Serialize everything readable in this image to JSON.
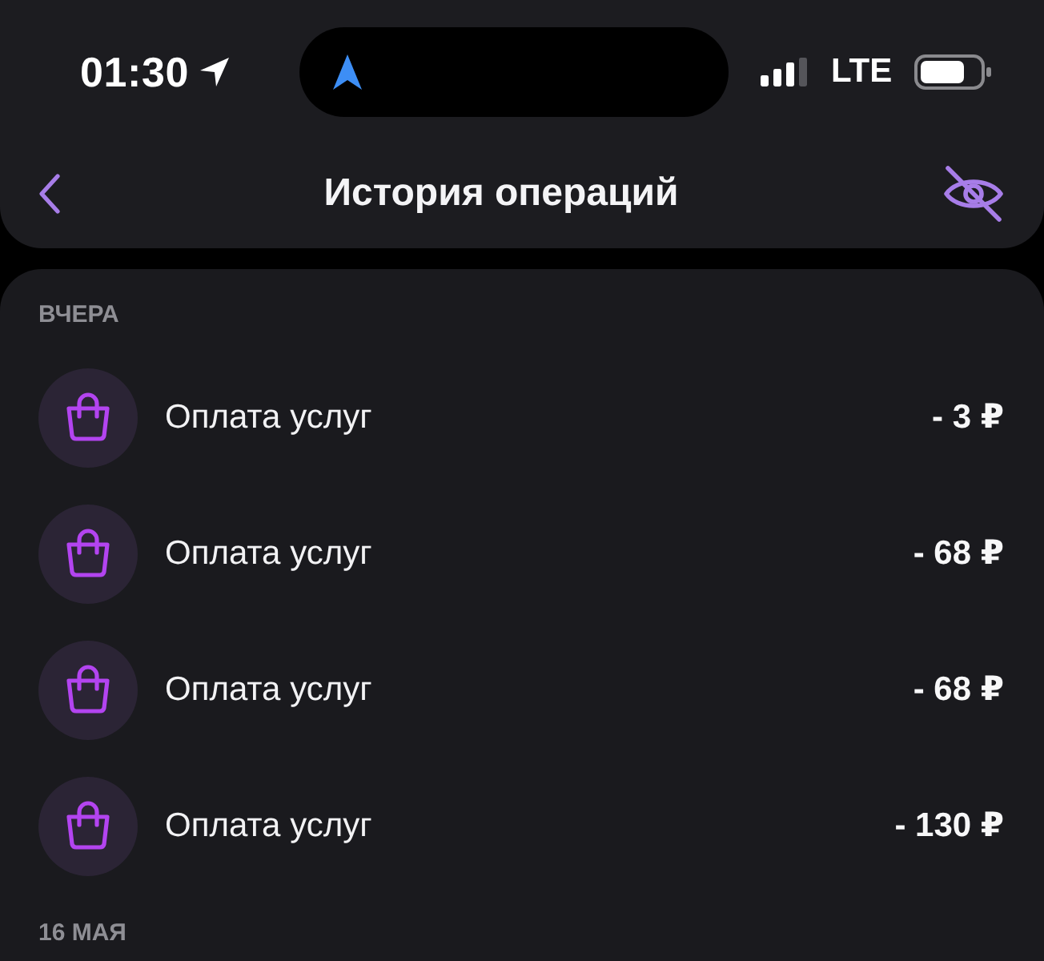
{
  "status_bar": {
    "time": "01:30",
    "network": "LTE"
  },
  "header": {
    "title": "История операций"
  },
  "sections": [
    {
      "label": "ВЧЕРА",
      "operations": [
        {
          "title": "Оплата услуг",
          "amount": "- 3 ₽"
        },
        {
          "title": "Оплата услуг",
          "amount": "- 68 ₽"
        },
        {
          "title": "Оплата услуг",
          "amount": "- 68 ₽"
        },
        {
          "title": "Оплата услуг",
          "amount": "- 130 ₽"
        }
      ]
    },
    {
      "label": "16 МАЯ"
    }
  ]
}
